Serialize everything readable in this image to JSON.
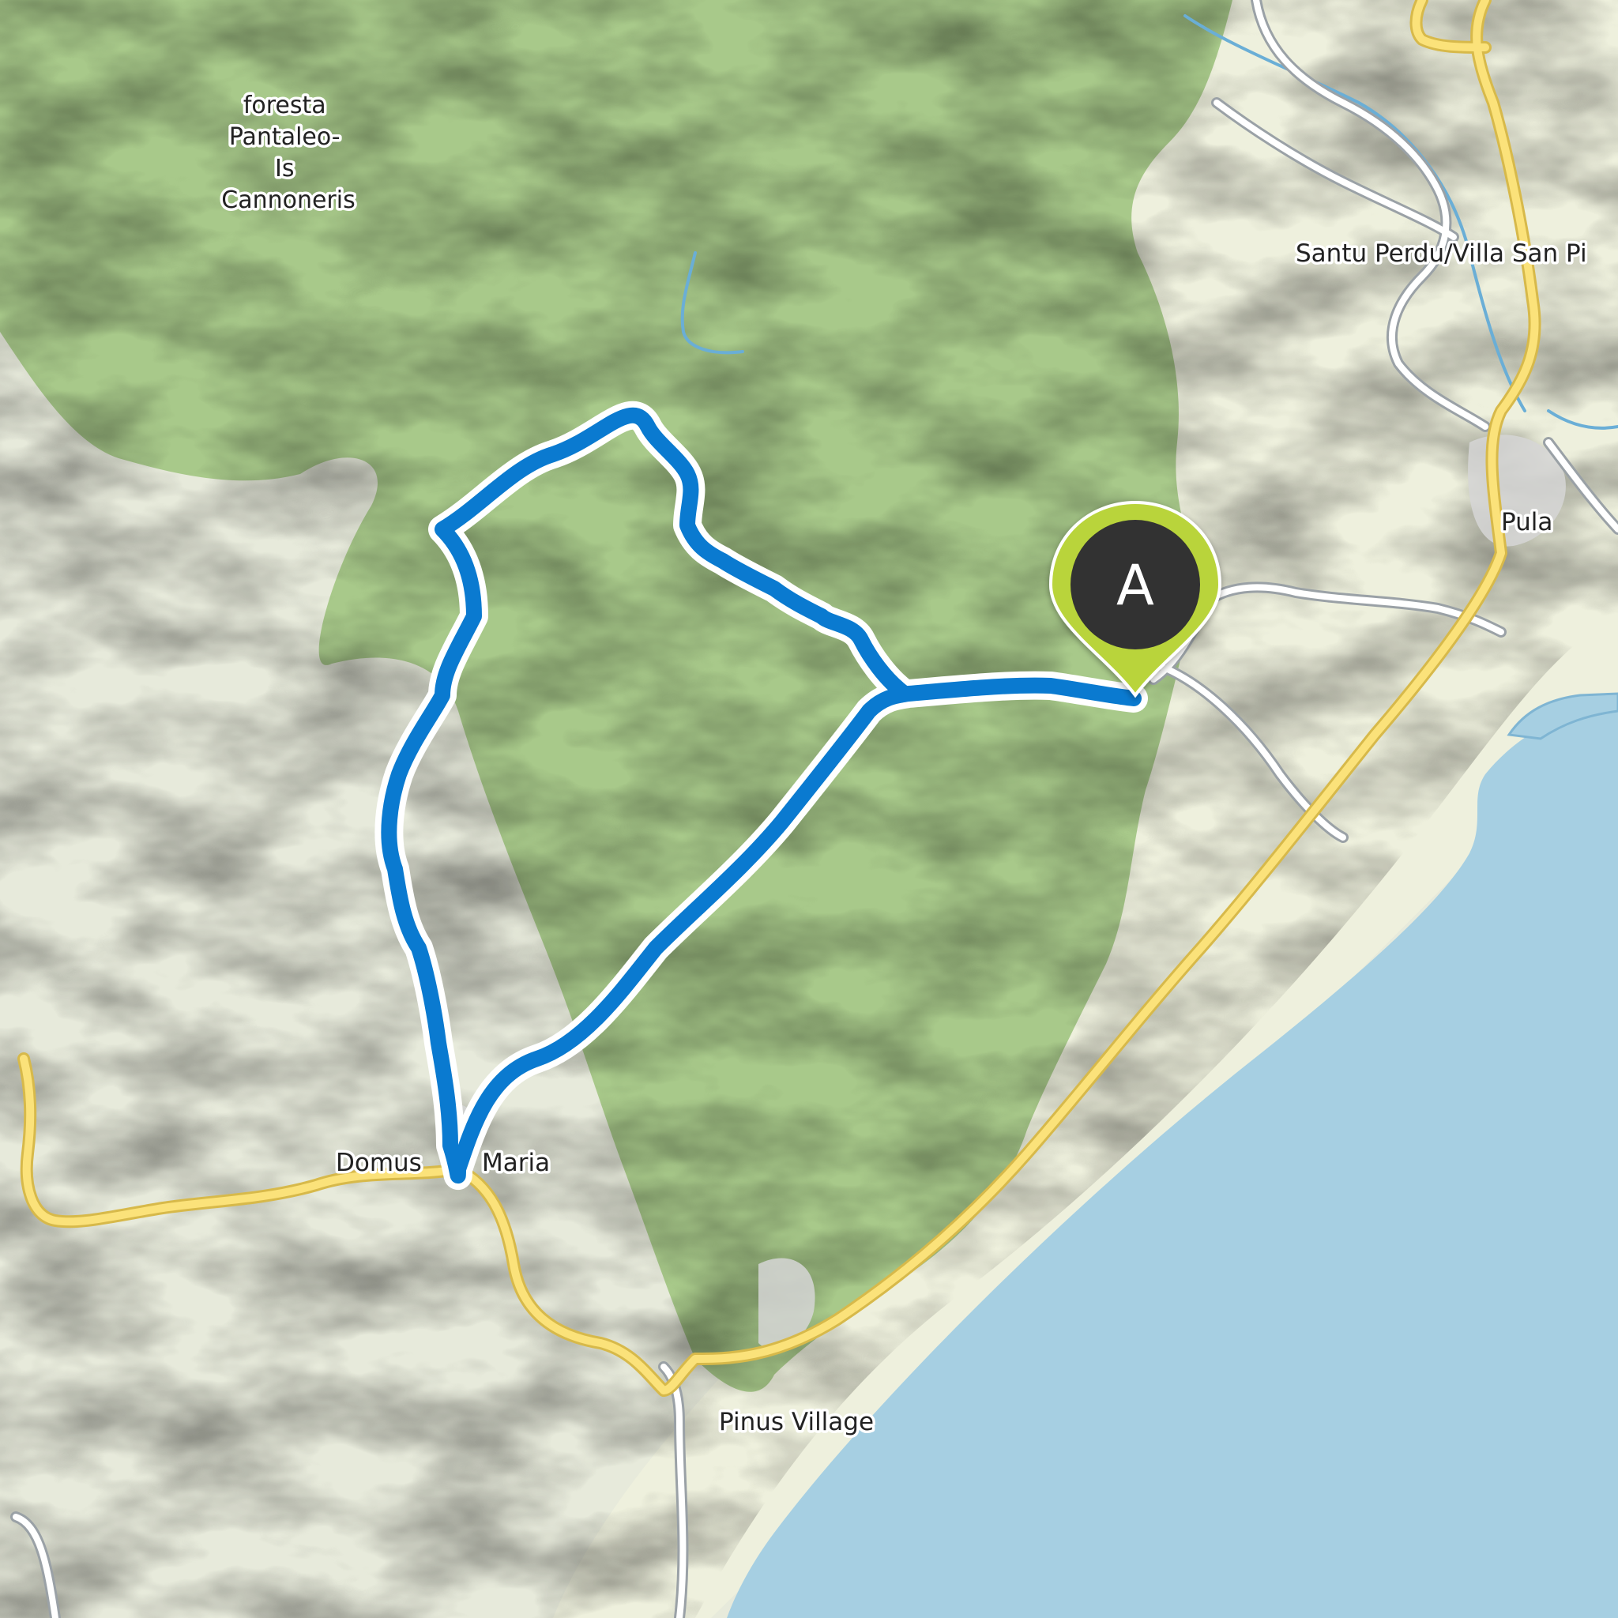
{
  "map": {
    "places": [
      {
        "id": "foresta",
        "lines": [
          "foresta",
          "Pantaleo-",
          "Is",
          "Cannoneris"
        ]
      },
      {
        "id": "santu-perdu",
        "lines": [
          "Santu Perdu/Villa San Pi"
        ]
      },
      {
        "id": "pula",
        "lines": [
          "Pula"
        ]
      },
      {
        "id": "domus",
        "lines": [
          "Domus"
        ]
      },
      {
        "id": "maria",
        "lines": [
          "Maria"
        ]
      },
      {
        "id": "pinus",
        "lines": [
          "Pinus Village"
        ]
      }
    ],
    "start_marker": {
      "letter": "A",
      "label_color": "#ffffff"
    },
    "colors": {
      "route": "#0a7ad0",
      "route_casing": "#ffffff",
      "sea": "#a6cfe2",
      "coast_land": "#eef0dd",
      "forest": "#a8c98a",
      "hills": "#e7eadb",
      "main_road": "#fbe27a",
      "main_road_casing": "#d7b94a",
      "minor_road": "#ffffff",
      "minor_road_casing": "#9aa1a6",
      "river": "#6aaed6",
      "urban": "#d6d6d6",
      "marker_fill": "#333333",
      "marker_ring": "#b9d43a"
    }
  }
}
